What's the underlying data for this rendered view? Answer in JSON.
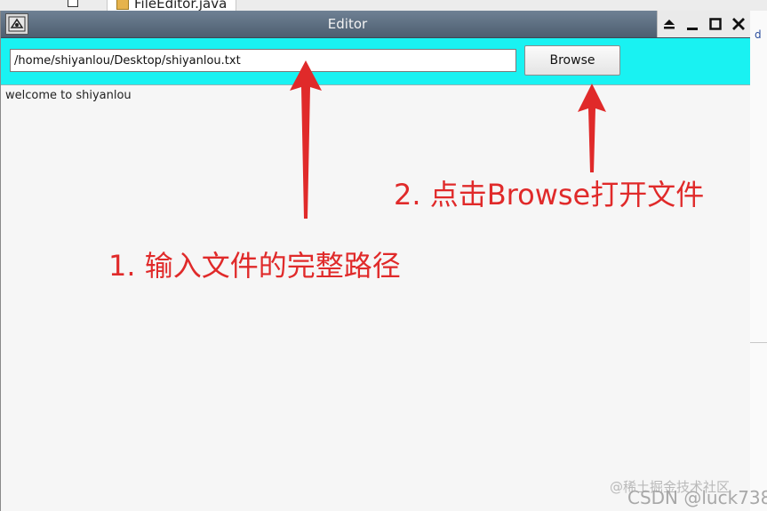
{
  "background_ide": {
    "tab_label": "FileEditor.java",
    "gutter_text": "d"
  },
  "window": {
    "title": "Editor",
    "controls": {
      "shade_icon": "eject-shade-icon",
      "minimize_icon": "minimize-icon",
      "maximize_icon": "maximize-icon",
      "close_icon": "close-icon"
    }
  },
  "toolbar": {
    "path_value": "/home/shiyanlou/Desktop/shiyanlou.txt",
    "browse_label": "Browse"
  },
  "editor": {
    "content": "welcome to shiyanlou"
  },
  "annotations": {
    "step1": "1. 输入文件的完整路径",
    "step2": "2. 点击Browse打开文件"
  },
  "watermark": {
    "line1": "@稀土掘金技术社区",
    "line2": "CSDN @luck738"
  },
  "colors": {
    "toolbar_bg": "#19f2f2",
    "annotation": "#e02a2a",
    "titlebar": "#5a6b7d"
  }
}
